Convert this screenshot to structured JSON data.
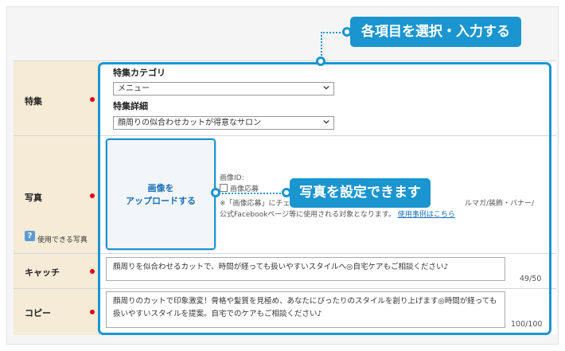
{
  "callouts": {
    "top": "各項目を選択・入力する",
    "photo": "写真を設定できます"
  },
  "feature": {
    "label": "特集",
    "category_heading": "特集カテゴリ",
    "category_value": "メニュー",
    "detail_heading": "特集詳細",
    "detail_value": "顔周りの似合わせカットが得意なサロン"
  },
  "photo": {
    "label": "写真",
    "help_label": "使用できる写真",
    "upload_line1": "画像を",
    "upload_line2": "アップロードする",
    "image_id_label": "画像ID:",
    "checkbox_label": "画像応募",
    "note_line1_start": "※「画像応募」にチェ",
    "note_line1_end": "ルマガ/装飾・バナー/",
    "note_line2_start": "公式Facebookページ等に使用される対象となります。",
    "note_link": "使用事例はこちら"
  },
  "catch": {
    "label": "キャッチ",
    "value": "顔周りを似合わせるカットで、時間が経っても扱いやすいスタイルへ◎自宅ケアもご相談ください♪",
    "counter": "49/50"
  },
  "copy": {
    "label": "コピー",
    "value": "顔周りのカットで印象激変！骨格や髪質を見極め、あなたにぴったりのスタイルを創り上げます◎時間が経っても扱いやすいスタイルを提案。自宅でのケアもご相談ください♪",
    "counter": "100/100"
  },
  "colors": {
    "accent": "#1a95d0",
    "label_bg": "#f5ebd6",
    "required": "#e60012"
  }
}
